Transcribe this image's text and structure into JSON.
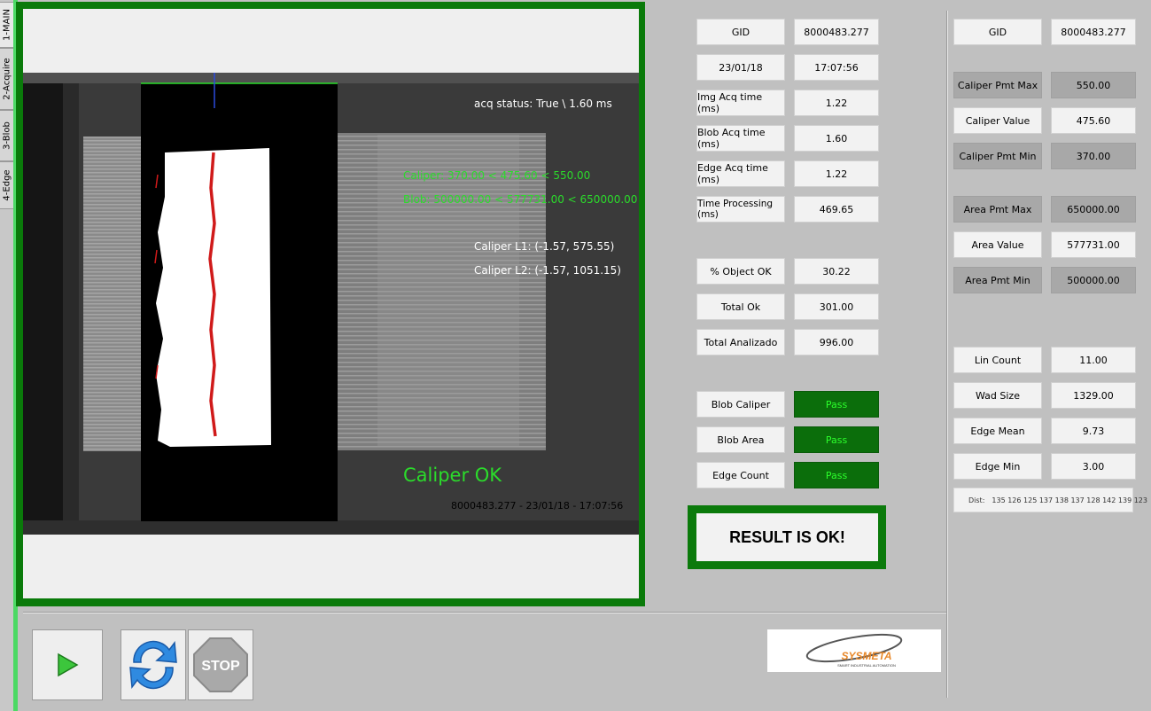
{
  "tabs": [
    {
      "label": "1-MAIN",
      "active": true
    },
    {
      "label": "2-Acquire",
      "active": false
    },
    {
      "label": "3-Blob",
      "active": false
    },
    {
      "label": "4-Edge",
      "active": false
    }
  ],
  "overlay": {
    "acq_status": "acq status: True \\ 1.60 ms",
    "caliper_range": "Caliper: 370.00 < 475.60 < 550.00",
    "blob_range": "Blob: 500000.00 < 577731.00 < 650000.00",
    "caliper_l1": "Caliper L1: (-1.57, 575.55)",
    "caliper_l2": "Caliper L2: (-1.57, 1051.15)",
    "caliper_ok": "Caliper OK",
    "footer": "8000483.277 - 23/01/18 - 17:07:56"
  },
  "info": {
    "gid_label": "GID",
    "gid_value": "8000483.277",
    "date": "23/01/18",
    "time": "17:07:56",
    "img_acq_label": "Img Acq time (ms)",
    "img_acq_value": "1.22",
    "blob_acq_label": "Blob Acq time (ms)",
    "blob_acq_value": "1.60",
    "edge_acq_label": "Edge Acq time (ms)",
    "edge_acq_value": "1.22",
    "proc_label": "Time Processing (ms)",
    "proc_value": "469.65",
    "pct_ok_label": "% Object OK",
    "pct_ok_value": "30.22",
    "total_ok_label": "Total Ok",
    "total_ok_value": "301.00",
    "total_an_label": "Total Analizado",
    "total_an_value": "996.00",
    "blob_caliper_label": "Blob Caliper",
    "blob_caliper_status": "Pass",
    "blob_area_label": "Blob Area",
    "blob_area_status": "Pass",
    "edge_count_label": "Edge Count",
    "edge_count_status": "Pass",
    "result": "RESULT IS OK!"
  },
  "right": {
    "gid_label": "GID",
    "gid_value": "8000483.277",
    "cal_max_label": "Caliper Pmt Max",
    "cal_max_value": "550.00",
    "cal_val_label": "Caliper Value",
    "cal_val_value": "475.60",
    "cal_min_label": "Caliper Pmt Min",
    "cal_min_value": "370.00",
    "area_max_label": "Area Pmt Max",
    "area_max_value": "650000.00",
    "area_val_label": "Area Value",
    "area_val_value": "577731.00",
    "area_min_label": "Area Pmt Min",
    "area_min_value": "500000.00",
    "lin_label": "Lin Count",
    "lin_value": "11.00",
    "wad_label": "Wad Size",
    "wad_value": "1329.00",
    "edge_mean_label": "Edge Mean",
    "edge_mean_value": "9.73",
    "edge_min_label": "Edge Min",
    "edge_min_value": "3.00",
    "dist_label": "Dist:",
    "dist_values": "135 126 125 137 138 137 128 142 139 123"
  },
  "controls": {
    "stop_label": "STOP",
    "logo_text": "SYSMETA",
    "logo_tagline": "SMART INDUSTRIAL AUTOMATION"
  },
  "colors": {
    "frame_green": "#0a7a0a",
    "pass_green": "#0b6e0b",
    "overlay_green": "#2bdc2b",
    "tab_accent": "#4cd964",
    "logo_orange": "#e8882a"
  }
}
